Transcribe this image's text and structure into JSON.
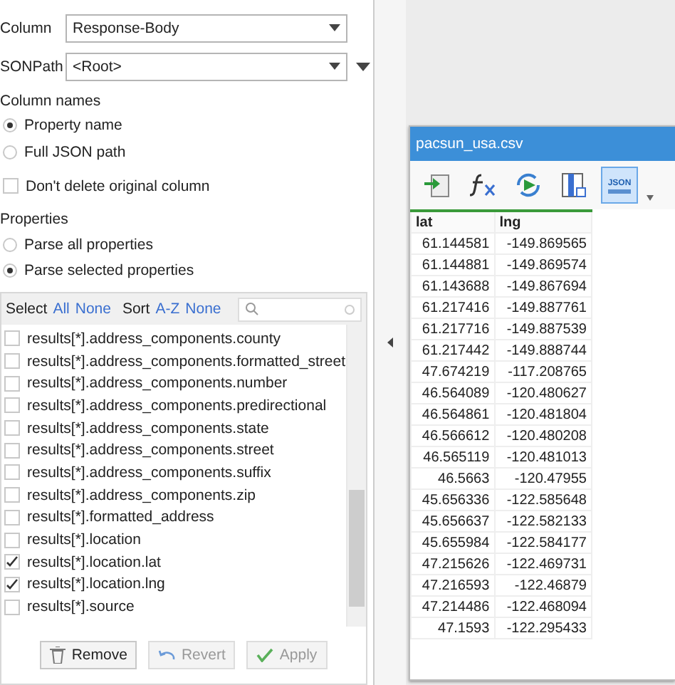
{
  "fields": [
    {
      "label": "Column",
      "value": "Response-Body",
      "extra_menu": false
    },
    {
      "label": "SONPath",
      "value": "<Root>",
      "extra_menu": true
    }
  ],
  "column_names": {
    "title": "Column names",
    "options": [
      {
        "label": "Property name",
        "selected": true
      },
      {
        "label": "Full JSON path",
        "selected": false
      }
    ]
  },
  "keep_original": {
    "label": "Don't delete original column",
    "checked": false
  },
  "properties": {
    "title": "Properties",
    "options": [
      {
        "label": "Parse all properties",
        "selected": false
      },
      {
        "label": "Parse selected properties",
        "selected": true
      }
    ]
  },
  "list_toolbar": {
    "select_label": "Select",
    "select_links": [
      "All",
      "None"
    ],
    "sort_label": "Sort",
    "sort_links": [
      "A-Z",
      "None"
    ]
  },
  "property_list": [
    {
      "label": "results[*].address_components.county",
      "checked": false
    },
    {
      "label": "results[*].address_components.formatted_street",
      "checked": false
    },
    {
      "label": "results[*].address_components.number",
      "checked": false
    },
    {
      "label": "results[*].address_components.predirectional",
      "checked": false
    },
    {
      "label": "results[*].address_components.state",
      "checked": false
    },
    {
      "label": "results[*].address_components.street",
      "checked": false
    },
    {
      "label": "results[*].address_components.suffix",
      "checked": false
    },
    {
      "label": "results[*].address_components.zip",
      "checked": false
    },
    {
      "label": "results[*].formatted_address",
      "checked": false
    },
    {
      "label": "results[*].location",
      "checked": false
    },
    {
      "label": "results[*].location.lat",
      "checked": true
    },
    {
      "label": "results[*].location.lng",
      "checked": true
    },
    {
      "label": "results[*].source",
      "checked": false
    }
  ],
  "buttons": [
    {
      "kind": "remove",
      "label": "Remove",
      "disabled": false
    },
    {
      "kind": "revert",
      "label": "Revert",
      "disabled": true
    },
    {
      "kind": "apply",
      "label": "Apply",
      "disabled": true
    }
  ],
  "table_window": {
    "title": "pacsun_usa.csv",
    "toolbar": [
      {
        "kind": "import",
        "selected": false
      },
      {
        "kind": "formula",
        "selected": false
      },
      {
        "kind": "refresh",
        "selected": false
      },
      {
        "kind": "columns",
        "selected": false
      },
      {
        "kind": "json",
        "label": "JSON",
        "selected": true
      }
    ],
    "columns": [
      "lat",
      "lng"
    ],
    "rows": [
      [
        "61.144581",
        "-149.869565"
      ],
      [
        "61.144881",
        "-149.869574"
      ],
      [
        "61.143688",
        "-149.867694"
      ],
      [
        "61.217416",
        "-149.887761"
      ],
      [
        "61.217716",
        "-149.887539"
      ],
      [
        "61.217442",
        "-149.888744"
      ],
      [
        "47.674219",
        "-117.208765"
      ],
      [
        "46.564089",
        "-120.480627"
      ],
      [
        "46.564861",
        "-120.481804"
      ],
      [
        "46.566612",
        "-120.480208"
      ],
      [
        "46.565119",
        "-120.481013"
      ],
      [
        "46.5663",
        "-120.47955"
      ],
      [
        "45.656336",
        "-122.585648"
      ],
      [
        "45.656637",
        "-122.582133"
      ],
      [
        "45.655984",
        "-122.584177"
      ],
      [
        "47.215626",
        "-122.469731"
      ],
      [
        "47.216593",
        "-122.46879"
      ],
      [
        "47.214486",
        "-122.468094"
      ],
      [
        "47.1593",
        "-122.295433"
      ]
    ]
  }
}
